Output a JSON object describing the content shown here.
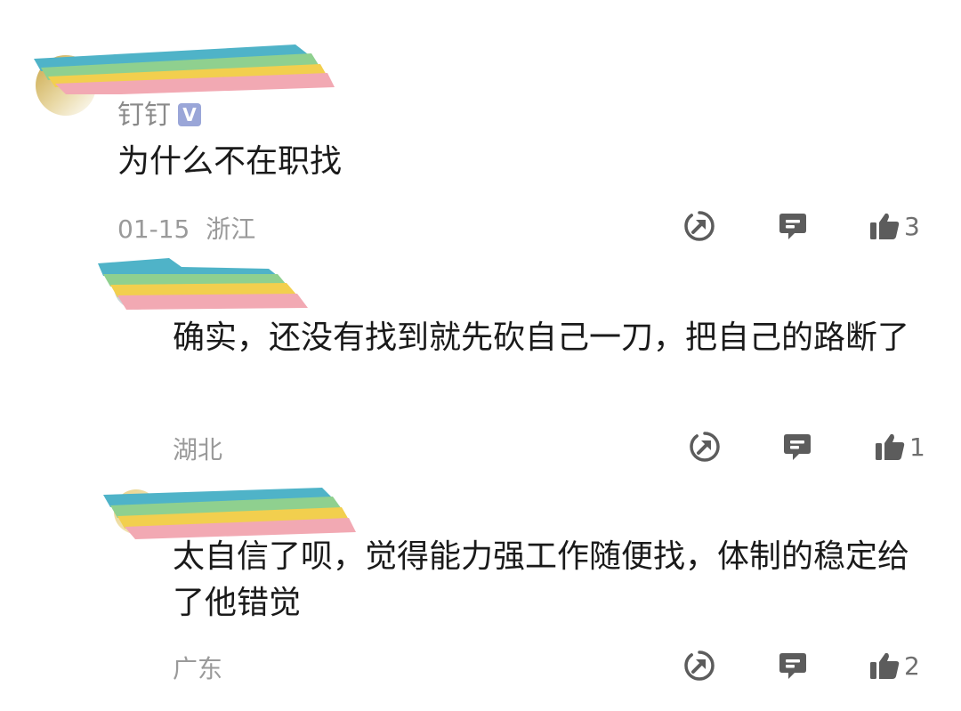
{
  "comments": [
    {
      "name": "钉钉",
      "verified": "V",
      "text": "为什么不在职找",
      "date": "01-15",
      "location": "浙江",
      "likes": "3"
    },
    {
      "name": "",
      "text": "确实，还没有找到就先砍自己一刀，把自己的路断了",
      "date": "",
      "location": "湖北",
      "likes": "1"
    },
    {
      "name": "",
      "text": "太自信了呗，觉得能力强工作随便找，体制的稳定给了他错觉",
      "date": "",
      "location": "广东",
      "likes": "2"
    }
  ],
  "icons": {
    "share": "share-arrow-icon",
    "reply": "reply-bubble-icon",
    "like": "thumbs-up-icon"
  },
  "colors": {
    "scribble": [
      "#4fb3c8",
      "#8fd08f",
      "#f2cf4e",
      "#f2a9b3"
    ],
    "icon": "#5c5c5c",
    "meta_text": "#9a9a9a"
  }
}
